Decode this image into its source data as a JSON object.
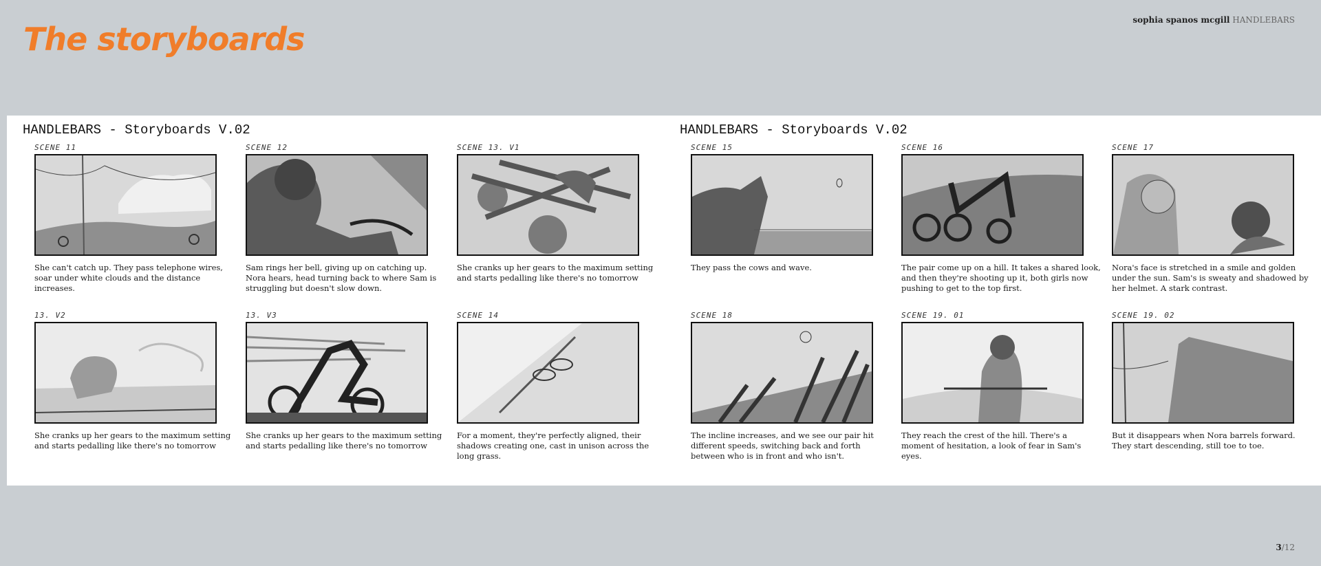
{
  "header": {
    "title": "The storyboards",
    "author": "sophia spanos mcgill",
    "project": "HANDLEBARS"
  },
  "boards": [
    {
      "title": "HANDLEBARS - Storyboards V.02",
      "panels": [
        {
          "scene": "SCENE 11",
          "caption": "She can't catch up. They pass telephone wires, soar under white clouds and the distance increases."
        },
        {
          "scene": "SCENE 12",
          "caption": "Sam rings her bell, giving up on catching up. Nora hears, head turning back to where Sam is struggling but doesn't slow down."
        },
        {
          "scene": "SCENE 13. V1",
          "caption": "She cranks up her gears to the maximum setting and starts pedalling like there's no tomorrow"
        },
        {
          "scene": "13. V2",
          "caption": "She cranks up her gears to the maximum setting and starts pedalling like there's no tomorrow"
        },
        {
          "scene": "13. V3",
          "caption": "She cranks up her gears to the maximum setting and starts pedalling like there's no tomorrow"
        },
        {
          "scene": "SCENE 14",
          "caption": "For a moment, they're perfectly aligned, their shadows creating one, cast in unison across the long grass."
        }
      ]
    },
    {
      "title": "HANDLEBARS - Storyboards V.02",
      "panels": [
        {
          "scene": "SCENE 15",
          "caption": "They pass the cows and wave."
        },
        {
          "scene": "SCENE 16",
          "caption": "The pair come up on a hill. It takes a shared look, and then they're shooting up it, both girls now pushing to get to the top first."
        },
        {
          "scene": "SCENE 17",
          "caption": "Nora's face is stretched in a smile and golden under the sun. Sam's is sweaty and shadowed by her helmet. A stark contrast."
        },
        {
          "scene": "SCENE 18",
          "caption": "The incline increases, and we see our pair hit different speeds, switching back and forth between who is in front and who isn't."
        },
        {
          "scene": "SCENE 19. 01",
          "caption": "They reach the crest of the hill. There's a moment of hesitation, a look of fear in Sam's eyes."
        },
        {
          "scene": "SCENE 19. 02",
          "caption": "But it disappears when Nora barrels forward. They start descending, still toe to toe."
        }
      ]
    }
  ],
  "footer": {
    "current_page": "3",
    "total_pages": "/12"
  }
}
